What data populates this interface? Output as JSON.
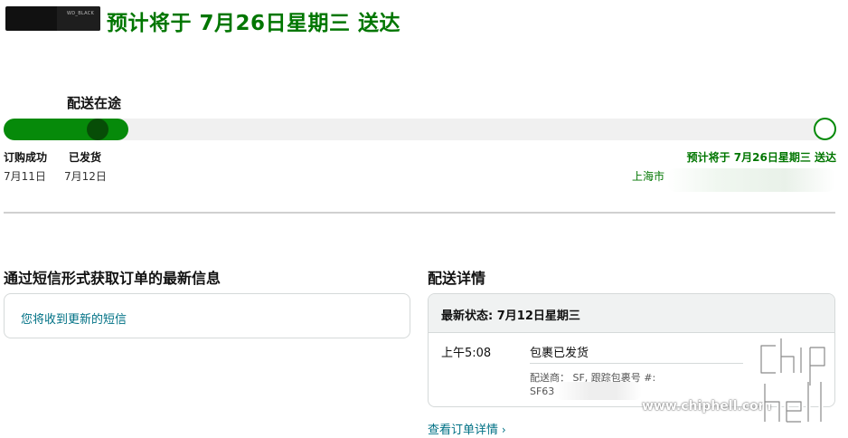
{
  "header": {
    "headline": "预计将于 7月26日星期三 送达",
    "product_thumb_text": "WD_BLACK"
  },
  "progress": {
    "status_title": "配送在途",
    "fraction_complete": 0.15,
    "milestones": [
      {
        "label": "订购成功",
        "date": "7月11日"
      },
      {
        "label": "已发货",
        "date": "7月12日"
      }
    ],
    "eta": "预计将于 7月26日星期三 送达",
    "address_prefix": "上海市 ",
    "colors": {
      "fill": "#068a0a",
      "current": "#074d07",
      "track": "#f0f0f0",
      "eta_text": "#007600"
    }
  },
  "sms": {
    "heading": "通过短信形式获取订单的最新信息",
    "prompt": "您将收到更新的短信"
  },
  "delivery": {
    "heading": "配送详情",
    "latest_status": "最新状态: 7月12日星期三",
    "event": {
      "time": "上午5:08",
      "title": "包裹已发货",
      "carrier": "配送商： SF, 跟踪包裹号 #:",
      "tracking_prefix": "SF63"
    },
    "view_details_link": "查看订单详情"
  },
  "watermark": {
    "url": "www.chiphell.com"
  }
}
